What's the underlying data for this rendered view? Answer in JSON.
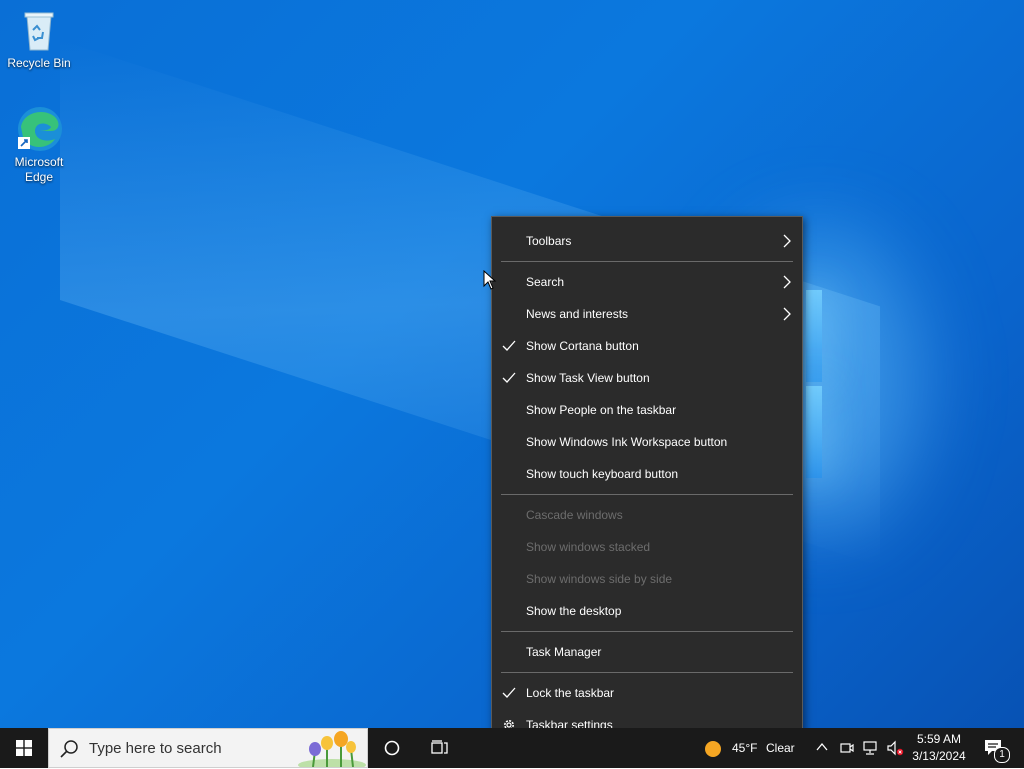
{
  "desktop": {
    "icons": [
      {
        "label": "Recycle Bin"
      },
      {
        "label": "Microsoft Edge"
      }
    ]
  },
  "context_menu": {
    "items": [
      {
        "label": "Toolbars",
        "checked": false,
        "submenu": true,
        "enabled": true
      },
      {
        "label": "Search",
        "checked": false,
        "submenu": true,
        "enabled": true
      },
      {
        "label": "News and interests",
        "checked": false,
        "submenu": true,
        "enabled": true
      },
      {
        "label": "Show Cortana button",
        "checked": true,
        "submenu": false,
        "enabled": true
      },
      {
        "label": "Show Task View button",
        "checked": true,
        "submenu": false,
        "enabled": true
      },
      {
        "label": "Show People on the taskbar",
        "checked": false,
        "submenu": false,
        "enabled": true
      },
      {
        "label": "Show Windows Ink Workspace button",
        "checked": false,
        "submenu": false,
        "enabled": true
      },
      {
        "label": "Show touch keyboard button",
        "checked": false,
        "submenu": false,
        "enabled": true
      },
      {
        "label": "Cascade windows",
        "checked": false,
        "submenu": false,
        "enabled": false
      },
      {
        "label": "Show windows stacked",
        "checked": false,
        "submenu": false,
        "enabled": false
      },
      {
        "label": "Show windows side by side",
        "checked": false,
        "submenu": false,
        "enabled": false
      },
      {
        "label": "Show the desktop",
        "checked": false,
        "submenu": false,
        "enabled": true
      },
      {
        "label": "Task Manager",
        "checked": false,
        "submenu": false,
        "enabled": true
      },
      {
        "label": "Lock the taskbar",
        "checked": true,
        "submenu": false,
        "enabled": true
      },
      {
        "label": "Taskbar settings",
        "checked": false,
        "submenu": false,
        "enabled": true,
        "icon": "gear-icon"
      }
    ]
  },
  "taskbar": {
    "search_placeholder": "Type here to search",
    "weather_temp": "45°F",
    "weather_text": "Clear",
    "time": "5:59 AM",
    "date": "3/13/2024",
    "notification_count": "1"
  },
  "colors": {
    "menu_bg": "#2b2b2b",
    "taskbar_bg": "#1a1a1a",
    "desktop_blue": "#0a6fd6"
  }
}
